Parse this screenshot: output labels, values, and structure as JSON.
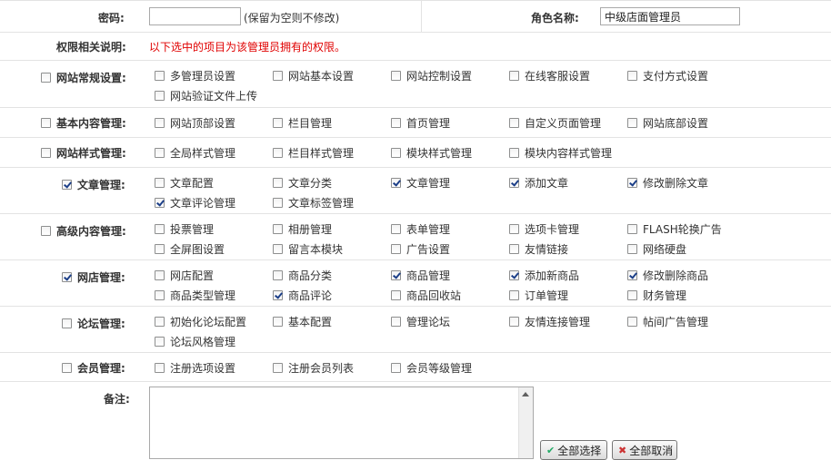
{
  "password": {
    "label": "密码:",
    "value": "",
    "hint": "(保留为空则不修改)"
  },
  "role_name": {
    "label": "角色名称:",
    "value": "中级店面管理员"
  },
  "permission_note": {
    "label": "权限相关说明:",
    "text": "以下选中的项目为该管理员拥有的权限。"
  },
  "groups": [
    {
      "label": "网站常规设置:",
      "checked": false,
      "options": [
        {
          "label": "多管理员设置",
          "checked": false
        },
        {
          "label": "网站基本设置",
          "checked": false
        },
        {
          "label": "网站控制设置",
          "checked": false
        },
        {
          "label": "在线客服设置",
          "checked": false
        },
        {
          "label": "支付方式设置",
          "checked": false
        },
        {
          "label": "网站验证文件上传",
          "checked": false
        }
      ]
    },
    {
      "label": "基本内容管理:",
      "checked": false,
      "options": [
        {
          "label": "网站顶部设置",
          "checked": false
        },
        {
          "label": "栏目管理",
          "checked": false
        },
        {
          "label": "首页管理",
          "checked": false
        },
        {
          "label": "自定义页面管理",
          "checked": false
        },
        {
          "label": "网站底部设置",
          "checked": false
        }
      ]
    },
    {
      "label": "网站样式管理:",
      "checked": false,
      "options": [
        {
          "label": "全局样式管理",
          "checked": false
        },
        {
          "label": "栏目样式管理",
          "checked": false
        },
        {
          "label": "模块样式管理",
          "checked": false
        },
        {
          "label": "模块内容样式管理",
          "checked": false
        }
      ]
    },
    {
      "label": "文章管理:",
      "checked": true,
      "options": [
        {
          "label": "文章配置",
          "checked": false
        },
        {
          "label": "文章分类",
          "checked": false
        },
        {
          "label": "文章管理",
          "checked": true
        },
        {
          "label": "添加文章",
          "checked": true
        },
        {
          "label": "修改删除文章",
          "checked": true
        },
        {
          "label": "文章评论管理",
          "checked": true
        },
        {
          "label": "文章标签管理",
          "checked": false
        }
      ]
    },
    {
      "label": "高级内容管理:",
      "checked": false,
      "options": [
        {
          "label": "投票管理",
          "checked": false
        },
        {
          "label": "相册管理",
          "checked": false
        },
        {
          "label": "表单管理",
          "checked": false
        },
        {
          "label": "选项卡管理",
          "checked": false
        },
        {
          "label": "FLASH轮换广告",
          "checked": false
        },
        {
          "label": "全屏图设置",
          "checked": false
        },
        {
          "label": "留言本模块",
          "checked": false
        },
        {
          "label": "广告设置",
          "checked": false
        },
        {
          "label": "友情链接",
          "checked": false
        },
        {
          "label": "网络硬盘",
          "checked": false
        }
      ]
    },
    {
      "label": "网店管理:",
      "checked": true,
      "options": [
        {
          "label": "网店配置",
          "checked": false
        },
        {
          "label": "商品分类",
          "checked": false
        },
        {
          "label": "商品管理",
          "checked": true
        },
        {
          "label": "添加新商品",
          "checked": true
        },
        {
          "label": "修改删除商品",
          "checked": true
        },
        {
          "label": "商品类型管理",
          "checked": false
        },
        {
          "label": "商品评论",
          "checked": true
        },
        {
          "label": "商品回收站",
          "checked": false
        },
        {
          "label": "订单管理",
          "checked": false
        },
        {
          "label": "财务管理",
          "checked": false
        }
      ]
    },
    {
      "label": "论坛管理:",
      "checked": false,
      "options": [
        {
          "label": "初始化论坛配置",
          "checked": false
        },
        {
          "label": "基本配置",
          "checked": false
        },
        {
          "label": "管理论坛",
          "checked": false
        },
        {
          "label": "友情连接管理",
          "checked": false
        },
        {
          "label": "帖间广告管理",
          "checked": false
        },
        {
          "label": "论坛风格管理",
          "checked": false
        }
      ]
    },
    {
      "label": "会员管理:",
      "checked": false,
      "options": [
        {
          "label": "注册选项设置",
          "checked": false
        },
        {
          "label": "注册会员列表",
          "checked": false
        },
        {
          "label": "会员等级管理",
          "checked": false
        }
      ]
    }
  ],
  "remark": {
    "label": "备注:",
    "value": ""
  },
  "buttons": {
    "select_all": "全部选择",
    "deselect_all": "全部取消"
  }
}
